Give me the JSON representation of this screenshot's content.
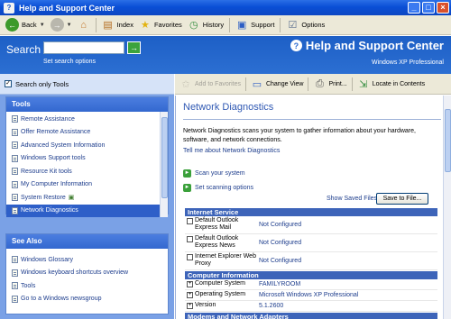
{
  "window": {
    "title": "Help and Support Center"
  },
  "toolbar": {
    "back": "Back",
    "index": "Index",
    "favorites": "Favorites",
    "history": "History",
    "support": "Support",
    "options": "Options"
  },
  "header": {
    "search_label": "Search",
    "search_value": "",
    "search_options": "Set search options",
    "brand_title": "Help and Support Center",
    "os_name": "Windows XP Professional"
  },
  "left": {
    "search_only": "Search only Tools",
    "tools_title": "Tools",
    "tools_items": [
      "Remote Assistance",
      "Offer Remote Assistance",
      "Advanced System Information",
      "Windows Support tools",
      "Resource Kit tools",
      "My Computer Information",
      "System Restore",
      "Network Diagnostics"
    ],
    "see_also_title": "See Also",
    "see_also_items": [
      "Windows Glossary",
      "Windows keyboard shortcuts overview",
      "Tools",
      "Go to a Windows newsgroup"
    ]
  },
  "content_toolbar": {
    "add_fav": "Add to Favorites",
    "change_view": "Change View",
    "print": "Print...",
    "locate": "Locate in Contents"
  },
  "content": {
    "title": "Network Diagnostics",
    "description": "Network Diagnostics scans your system to gather information about your hardware, software, and network connections.",
    "learn_link": "Tell me about Network Diagnostics",
    "scan": "Scan your system",
    "set_options": "Set scanning options",
    "show_saved": "Show Saved Files",
    "save_btn": "Save to File...",
    "sections": {
      "internet": "Internet Service",
      "computer": "Computer Information",
      "modems": "Modems and Network Adapters"
    },
    "internet_rows": [
      {
        "label": "Default Outlook Express Mail",
        "value": "Not Configured"
      },
      {
        "label": "Default Outlook Express News",
        "value": "Not Configured"
      },
      {
        "label": "Internet Explorer Web Proxy",
        "value": "Not Configured"
      }
    ],
    "computer_rows": [
      {
        "label": "Computer System",
        "value": "FAMILYROOM"
      },
      {
        "label": "Operating System",
        "value": "Microsoft Windows XP Professional"
      },
      {
        "label": "Version",
        "value": "5.1.2600"
      }
    ]
  },
  "colors": {
    "titlebar": "#0a4fd6",
    "header": "#1d5fc6",
    "left_panel": "#7aa1e6",
    "link": "#1c3c8c",
    "section": "#3d64b9"
  }
}
